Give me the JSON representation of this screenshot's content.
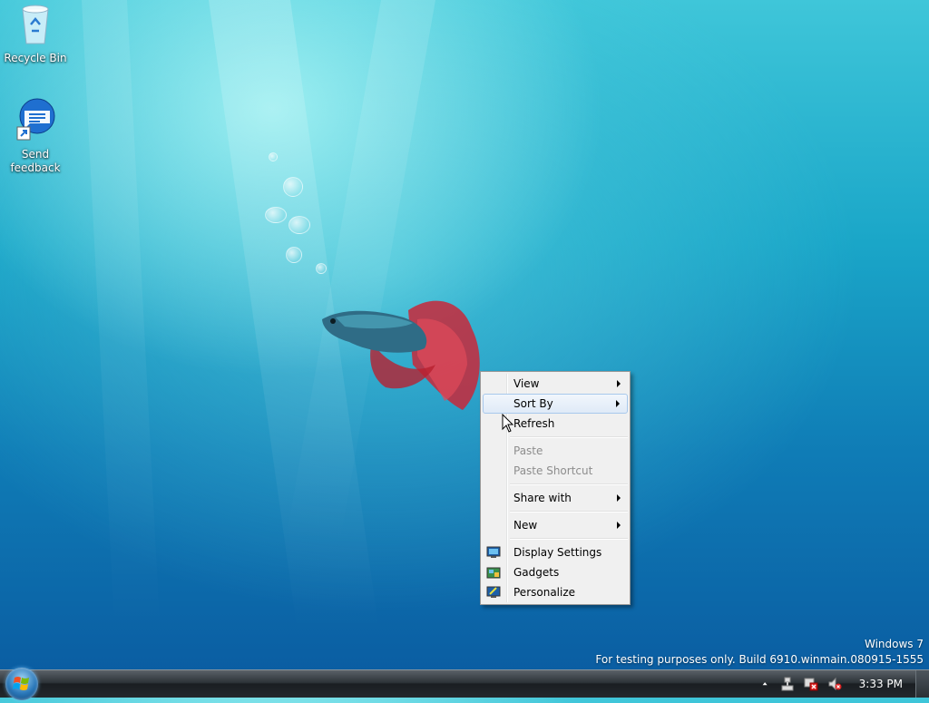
{
  "desktop": {
    "icons": [
      {
        "label": "Recycle Bin",
        "icon": "recycle-bin-icon"
      },
      {
        "label": "Send feedback",
        "icon": "send-feedback-icon"
      }
    ]
  },
  "context_menu": {
    "items": [
      {
        "label": "View",
        "submenu": true
      },
      {
        "label": "Sort By",
        "submenu": true,
        "highlighted": true
      },
      {
        "label": "Refresh"
      },
      {
        "label": "Paste",
        "disabled": true
      },
      {
        "label": "Paste Shortcut",
        "disabled": true
      },
      {
        "label": "Share with",
        "submenu": true
      },
      {
        "label": "New",
        "submenu": true
      },
      {
        "label": "Display Settings",
        "icon": "display-settings-icon"
      },
      {
        "label": "Gadgets",
        "icon": "gadgets-icon"
      },
      {
        "label": "Personalize",
        "icon": "personalize-icon"
      }
    ]
  },
  "watermark": {
    "line1": "Windows 7",
    "line2": "For testing purposes only. Build 6910.winmain.080915-1555"
  },
  "taskbar": {
    "start_icon": "windows-start-orb-icon",
    "tray_icons": [
      "show-hidden-icons-arrow",
      "network-icon",
      "action-center-icon",
      "volume-muted-icon"
    ],
    "clock": "3:33 PM"
  },
  "colors": {
    "menu_bg": "#f0f0f0",
    "menu_highlight": "#dfeaf7",
    "disabled_text": "#8d8d8d",
    "taskbar_bg": "#23282d"
  }
}
